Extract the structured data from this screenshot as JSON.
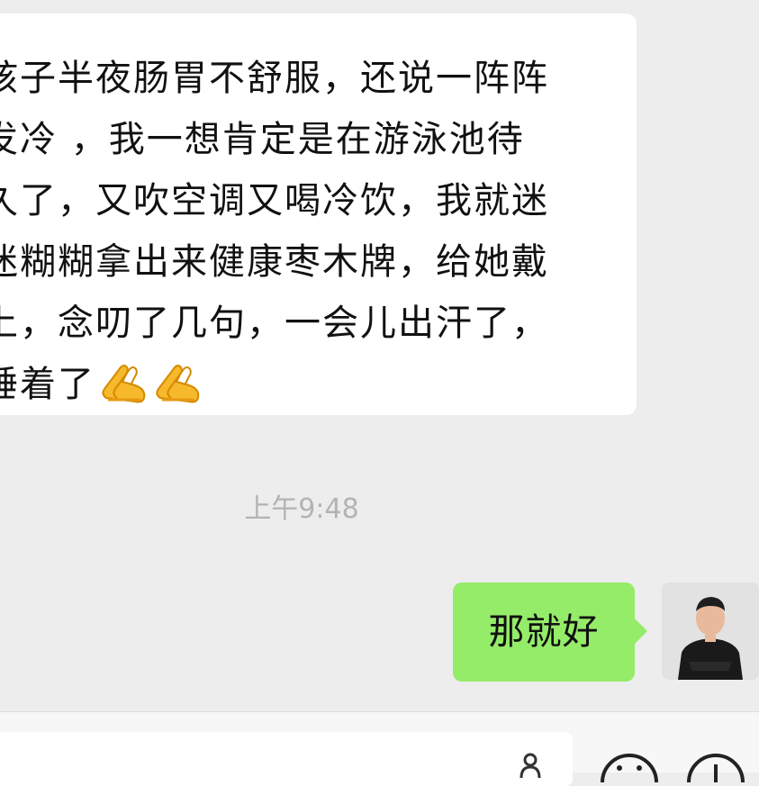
{
  "messages": {
    "incoming": {
      "lines": [
        "孩子半夜肠胃不舒服，还说一阵阵",
        "发冷 ，我一想肯定是在游泳池待",
        "久了，又吹空调又喝冷饮，我就迷",
        "迷糊糊拿出来健康枣木牌，给她戴",
        "上，念叨了几句，一会儿出汗了，",
        "睡着了"
      ],
      "emoji": [
        "folded-hands-icon",
        "folded-hands-icon"
      ]
    },
    "timestamp": "上午9:48",
    "outgoing": {
      "text": "那就好"
    }
  },
  "colors": {
    "background": "#ededed",
    "incoming_bubble": "#ffffff",
    "outgoing_bubble": "#95ec69",
    "timestamp": "#b3b3b3"
  }
}
